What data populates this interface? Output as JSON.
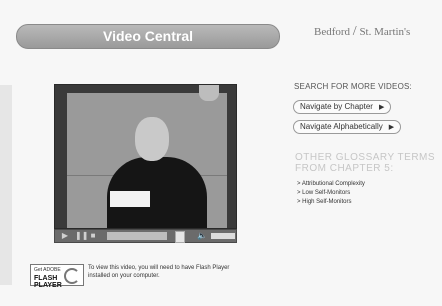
{
  "header": {
    "title": "Video Central",
    "brand": {
      "left": "Bedford",
      "slash": "/",
      "right": "St. Martin's"
    }
  },
  "search": {
    "heading": "SEARCH FOR MORE VIDEOS:",
    "buttons": [
      {
        "label": "Navigate by Chapter"
      },
      {
        "label": "Navigate Alphabetically"
      }
    ]
  },
  "glossary": {
    "heading_line1": "OTHER GLOSSARY TERMS",
    "heading_line2": "FROM CHAPTER 5:",
    "items": [
      {
        "label": "> Attributional Complexity"
      },
      {
        "label": "> Low Self-Monitors"
      },
      {
        "label": "> High Self-Monitors"
      }
    ]
  },
  "player": {
    "controls": {
      "play": "▶",
      "pause": "❚❚",
      "stop": "■",
      "speaker": "🔈"
    },
    "video_scene": "speaker-with-paper"
  },
  "flash": {
    "badge_get": "Get ADOBE",
    "badge_name": "FLASH PLAYER",
    "note": "To view this video, you will need to have Flash Player installed on your computer."
  },
  "colors": {
    "title_pill": "#9a9a9a",
    "accent": "#c6c6c6",
    "background": "#f7f7f7"
  }
}
